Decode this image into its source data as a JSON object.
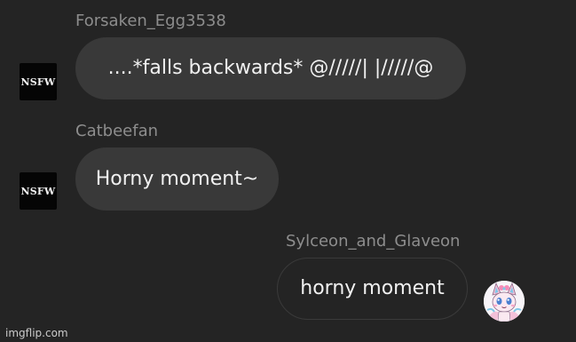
{
  "messages": [
    {
      "username": "Forsaken_Egg3538",
      "text": "....*falls backwards* @/////|  |/////@",
      "avatar_label": "NSFW",
      "avatar_icon": "nsfw-avatar-icon",
      "side": "left"
    },
    {
      "username": "Catbeefan",
      "text": "Horny moment~",
      "avatar_label": "NSFW",
      "avatar_icon": "nsfw-avatar-icon",
      "side": "left"
    },
    {
      "username": "Sylceon_and_Glaveon",
      "text": "horny moment",
      "avatar_icon": "sylveon-avatar-icon",
      "side": "right"
    }
  ],
  "watermark": "imgflip.com",
  "colors": {
    "background": "#242424",
    "bubble": "#393939",
    "username": "#8d8d8d",
    "text": "#f1f1f1"
  }
}
